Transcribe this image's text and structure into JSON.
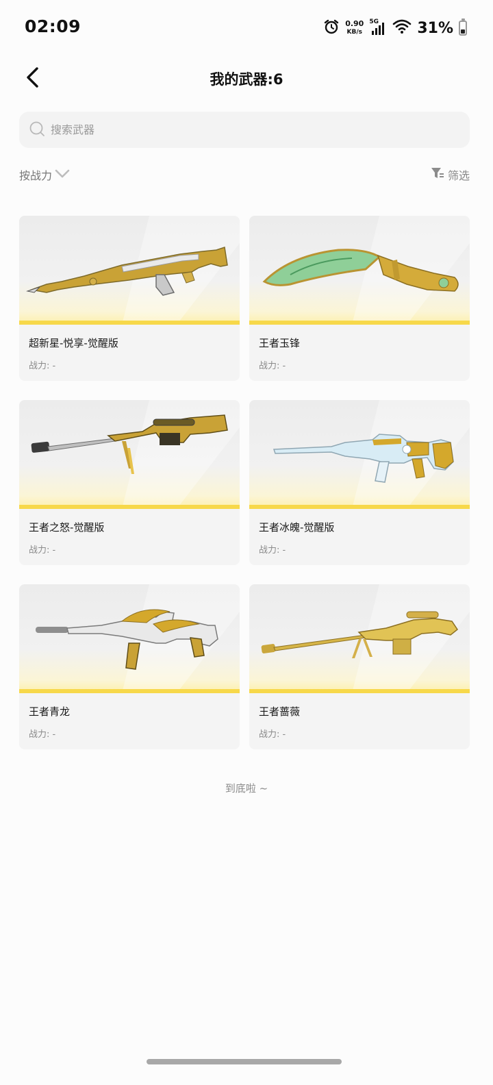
{
  "status_bar": {
    "time": "02:09",
    "net_speed_value": "0.90",
    "net_speed_unit": "KB/s",
    "signal_label": "5G",
    "battery_pct": "31%",
    "battery_level": 0.31
  },
  "header": {
    "title": "我的武器:6"
  },
  "search": {
    "placeholder": "搜索武器",
    "value": ""
  },
  "toolbar": {
    "sort_label": "按战力",
    "filter_label": "筛选"
  },
  "weapons": [
    {
      "name": "超新星-悦享-觉醒版",
      "power": "战力: -",
      "icon": "assault-rifle-gold-icon"
    },
    {
      "name": "王者玉锋",
      "power": "战力: -",
      "icon": "jade-blade-icon"
    },
    {
      "name": "王者之怒-觉醒版",
      "power": "战力: -",
      "icon": "sniper-rifle-gold-icon"
    },
    {
      "name": "王者冰魄-觉醒版",
      "power": "战力: -",
      "icon": "ice-rifle-icon"
    },
    {
      "name": "王者青龙",
      "power": "战力: -",
      "icon": "dragon-rifle-icon"
    },
    {
      "name": "王者蔷薇",
      "power": "战力: -",
      "icon": "gold-heavy-sniper-icon"
    }
  ],
  "footer": {
    "end_text": "到底啦 ~"
  },
  "colors": {
    "accent_yellow": "#f7d84a",
    "gold": "#d4a82c",
    "jade": "#7fc48c",
    "ice": "#cfe6f2"
  }
}
